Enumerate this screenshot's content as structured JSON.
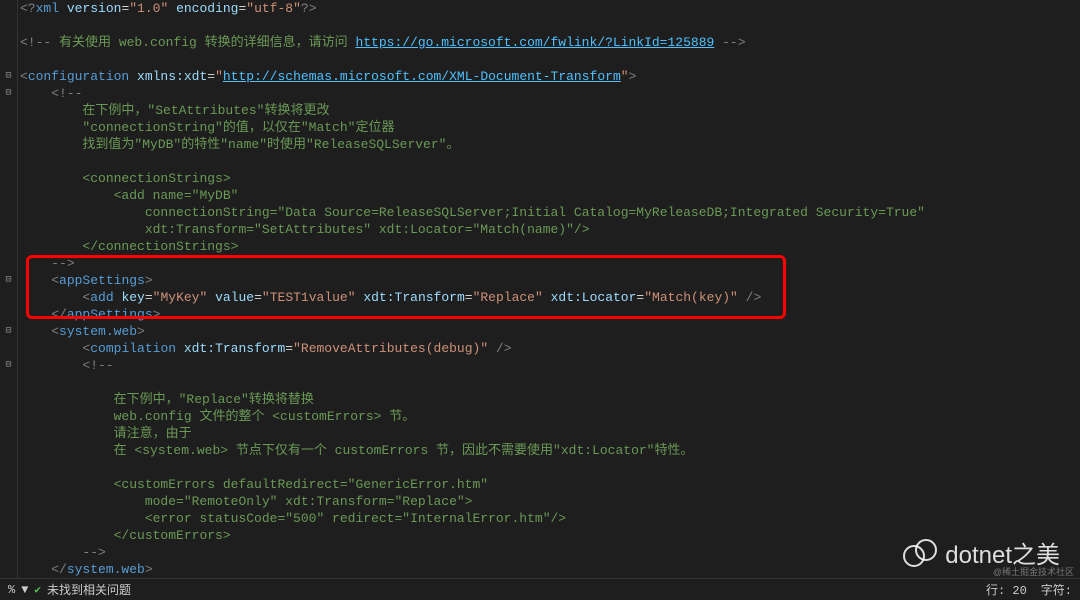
{
  "lines": [
    {
      "indent": 0,
      "fold": "",
      "spans": [
        {
          "c": "delim",
          "t": "<?"
        },
        {
          "c": "tag",
          "t": "xml "
        },
        {
          "c": "attr",
          "t": "version"
        },
        {
          "c": "eq",
          "t": "="
        },
        {
          "c": "string",
          "t": "\"1.0\" "
        },
        {
          "c": "attr",
          "t": "encoding"
        },
        {
          "c": "eq",
          "t": "="
        },
        {
          "c": "string",
          "t": "\"utf-8\""
        },
        {
          "c": "delim",
          "t": "?>"
        }
      ]
    },
    {
      "indent": 0,
      "fold": "",
      "spans": []
    },
    {
      "indent": 0,
      "fold": "",
      "spans": [
        {
          "c": "delim",
          "t": "<!-- "
        },
        {
          "c": "comment",
          "t": "有关使用 web.config 转换的详细信息，请访问 "
        },
        {
          "c": "link",
          "t": "https://go.microsoft.com/fwlink/?LinkId=125889"
        },
        {
          "c": "delim",
          "t": " -->"
        }
      ]
    },
    {
      "indent": 0,
      "fold": "",
      "spans": []
    },
    {
      "indent": 0,
      "fold": "⊟",
      "spans": [
        {
          "c": "delim",
          "t": "<"
        },
        {
          "c": "tag",
          "t": "configuration "
        },
        {
          "c": "attr",
          "t": "xmlns:xdt"
        },
        {
          "c": "eq",
          "t": "="
        },
        {
          "c": "string",
          "t": "\""
        },
        {
          "c": "link",
          "t": "http://schemas.microsoft.com/XML-Document-Transform"
        },
        {
          "c": "string",
          "t": "\""
        },
        {
          "c": "delim",
          "t": ">"
        }
      ]
    },
    {
      "indent": 2,
      "fold": "⊟",
      "spans": [
        {
          "c": "delim",
          "t": "<!--"
        }
      ]
    },
    {
      "indent": 4,
      "fold": "",
      "spans": [
        {
          "c": "comment",
          "t": "在下例中，\"SetAttributes\"转换将更改"
        }
      ]
    },
    {
      "indent": 4,
      "fold": "",
      "spans": [
        {
          "c": "comment",
          "t": "\"connectionString\"的值，以仅在\"Match\"定位器"
        }
      ]
    },
    {
      "indent": 4,
      "fold": "",
      "spans": [
        {
          "c": "comment",
          "t": "找到值为\"MyDB\"的特性\"name\"时使用\"ReleaseSQLServer\"。"
        }
      ]
    },
    {
      "indent": 0,
      "fold": "",
      "spans": []
    },
    {
      "indent": 4,
      "fold": "",
      "spans": [
        {
          "c": "comment",
          "t": "<connectionStrings>"
        }
      ]
    },
    {
      "indent": 6,
      "fold": "",
      "spans": [
        {
          "c": "comment",
          "t": "<add name=\"MyDB\""
        }
      ]
    },
    {
      "indent": 8,
      "fold": "",
      "spans": [
        {
          "c": "comment",
          "t": "connectionString=\"Data Source=ReleaseSQLServer;Initial Catalog=MyReleaseDB;Integrated Security=True\""
        }
      ]
    },
    {
      "indent": 8,
      "fold": "",
      "spans": [
        {
          "c": "comment",
          "t": "xdt:Transform=\"SetAttributes\" xdt:Locator=\"Match(name)\"/>"
        }
      ]
    },
    {
      "indent": 4,
      "fold": "",
      "spans": [
        {
          "c": "comment",
          "t": "</connectionStrings>"
        }
      ]
    },
    {
      "indent": 2,
      "fold": "",
      "spans": [
        {
          "c": "delim",
          "t": "-->"
        }
      ]
    },
    {
      "indent": 2,
      "fold": "⊟",
      "spans": [
        {
          "c": "delim",
          "t": "<"
        },
        {
          "c": "tag",
          "t": "appSettings"
        },
        {
          "c": "delim",
          "t": ">"
        }
      ]
    },
    {
      "indent": 4,
      "fold": "",
      "spans": [
        {
          "c": "delim",
          "t": "<"
        },
        {
          "c": "tag",
          "t": "add "
        },
        {
          "c": "attr",
          "t": "key"
        },
        {
          "c": "eq",
          "t": "="
        },
        {
          "c": "string",
          "t": "\"MyKey\" "
        },
        {
          "c": "attr",
          "t": "value"
        },
        {
          "c": "eq",
          "t": "="
        },
        {
          "c": "string",
          "t": "\"TEST1value\" "
        },
        {
          "c": "attr",
          "t": "xdt:Transform"
        },
        {
          "c": "eq",
          "t": "="
        },
        {
          "c": "string",
          "t": "\"Replace\" "
        },
        {
          "c": "attr",
          "t": "xdt:Locator"
        },
        {
          "c": "eq",
          "t": "="
        },
        {
          "c": "string",
          "t": "\"Match(key)\" "
        },
        {
          "c": "delim",
          "t": "/>"
        }
      ]
    },
    {
      "indent": 2,
      "fold": "",
      "spans": [
        {
          "c": "delim",
          "t": "</"
        },
        {
          "c": "tag",
          "t": "appSettings"
        },
        {
          "c": "delim",
          "t": ">"
        }
      ]
    },
    {
      "indent": 2,
      "fold": "⊟",
      "spans": [
        {
          "c": "delim",
          "t": "<"
        },
        {
          "c": "tag",
          "t": "system.web"
        },
        {
          "c": "delim",
          "t": ">"
        }
      ]
    },
    {
      "indent": 4,
      "fold": "",
      "spans": [
        {
          "c": "delim",
          "t": "<"
        },
        {
          "c": "tag",
          "t": "compilation "
        },
        {
          "c": "attr",
          "t": "xdt:Transform"
        },
        {
          "c": "eq",
          "t": "="
        },
        {
          "c": "string",
          "t": "\"RemoveAttributes(debug)\" "
        },
        {
          "c": "delim",
          "t": "/>"
        }
      ]
    },
    {
      "indent": 4,
      "fold": "⊟",
      "spans": [
        {
          "c": "delim",
          "t": "<!--"
        }
      ]
    },
    {
      "indent": 0,
      "fold": "",
      "spans": []
    },
    {
      "indent": 6,
      "fold": "",
      "spans": [
        {
          "c": "comment",
          "t": "在下例中，\"Replace\"转换将替换"
        }
      ]
    },
    {
      "indent": 6,
      "fold": "",
      "spans": [
        {
          "c": "comment",
          "t": "web.config 文件的整个 <customErrors> 节。"
        }
      ]
    },
    {
      "indent": 6,
      "fold": "",
      "spans": [
        {
          "c": "comment",
          "t": "请注意，由于"
        }
      ]
    },
    {
      "indent": 6,
      "fold": "",
      "spans": [
        {
          "c": "comment",
          "t": "在 <system.web> 节点下仅有一个 customErrors 节，因此不需要使用\"xdt:Locator\"特性。"
        }
      ]
    },
    {
      "indent": 0,
      "fold": "",
      "spans": []
    },
    {
      "indent": 6,
      "fold": "",
      "spans": [
        {
          "c": "comment",
          "t": "<customErrors defaultRedirect=\"GenericError.htm\""
        }
      ]
    },
    {
      "indent": 8,
      "fold": "",
      "spans": [
        {
          "c": "comment",
          "t": "mode=\"RemoteOnly\" xdt:Transform=\"Replace\">"
        }
      ]
    },
    {
      "indent": 8,
      "fold": "",
      "spans": [
        {
          "c": "comment",
          "t": "<error statusCode=\"500\" redirect=\"InternalError.htm\"/>"
        }
      ]
    },
    {
      "indent": 6,
      "fold": "",
      "spans": [
        {
          "c": "comment",
          "t": "</customErrors>"
        }
      ]
    },
    {
      "indent": 4,
      "fold": "",
      "spans": [
        {
          "c": "delim",
          "t": "-->"
        }
      ]
    },
    {
      "indent": 2,
      "fold": "",
      "spans": [
        {
          "c": "delim",
          "t": "</"
        },
        {
          "c": "tag",
          "t": "system.web"
        },
        {
          "c": "delim",
          "t": ">"
        }
      ]
    }
  ],
  "status": {
    "percent": "%",
    "arrow": "▼",
    "issues": "未找到相关问题",
    "line_label": "行: 20",
    "char_label": "字符:"
  },
  "watermark": "dotnet之美",
  "credit": "@稀土掘金技术社区"
}
